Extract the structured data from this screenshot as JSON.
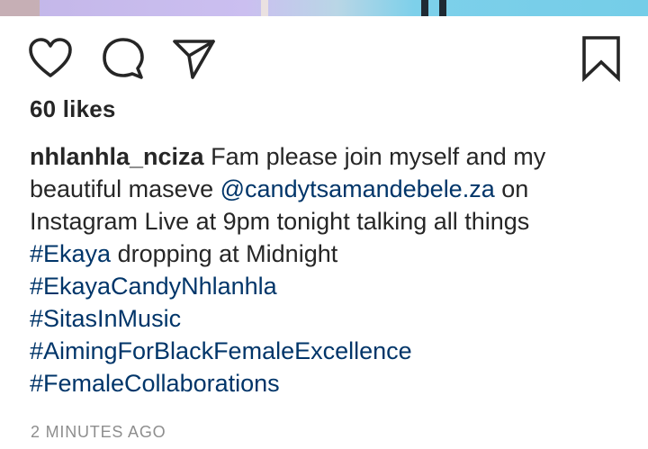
{
  "post": {
    "likes_text": "60 likes",
    "username": "nhlanhla_nciza",
    "caption_line1": "Fam please join myself and my",
    "caption_line2a": "beautiful maseve ",
    "mention": "@candytsamandebele.za",
    "caption_line2b": " on",
    "caption_line3": "Instagram Live at 9pm tonight talking all things",
    "hashtag_ekaya": "#Ekaya",
    "caption_line4b": " dropping at Midnight",
    "hashtags": [
      "#EkayaCandyNhlanhla",
      "#SitasInMusic",
      "#AimingForBlackFemaleExcellence",
      "#FemaleCollaborations"
    ],
    "timestamp": "2 MINUTES AGO"
  },
  "actions": {
    "like_icon": "heart-icon",
    "comment_icon": "comment-bubble-icon",
    "share_icon": "paper-plane-icon",
    "save_icon": "bookmark-icon"
  },
  "colors": {
    "text": "#262626",
    "link": "#003569",
    "muted": "#8e8e8e"
  }
}
